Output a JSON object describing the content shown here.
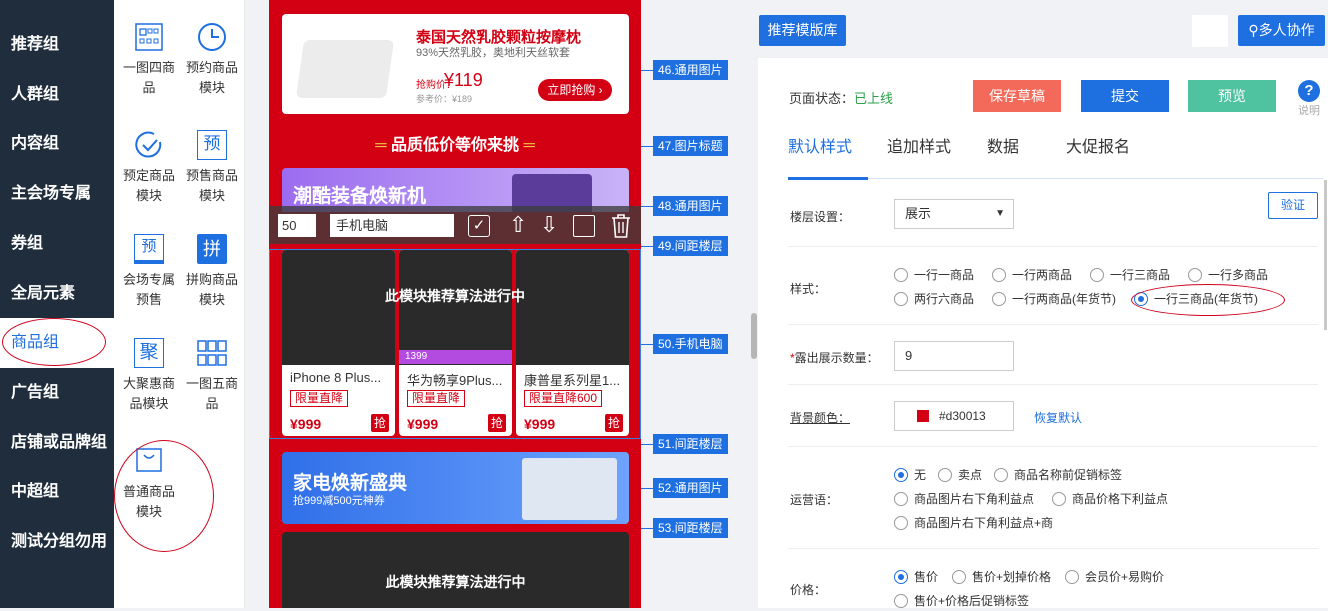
{
  "left_nav": {
    "groups": [
      {
        "label": "推荐组"
      },
      {
        "label": "人群组"
      },
      {
        "label": "内容组"
      },
      {
        "label": "主会场专属"
      },
      {
        "label": "券组"
      },
      {
        "label": "全局元素"
      },
      {
        "label": "商品组",
        "active": true
      },
      {
        "label": "广告组"
      },
      {
        "label": "店铺或品牌组"
      },
      {
        "label": "中超组"
      },
      {
        "label": "测试分组勿用"
      }
    ]
  },
  "modules": [
    {
      "label": "一图四商品",
      "icon": "grid-four-icon"
    },
    {
      "label": "预约商品模块",
      "icon": "clock-icon"
    },
    {
      "label": "预定商品模块",
      "icon": "check-circle-icon"
    },
    {
      "label": "预售商品模块",
      "icon": "yu-icon",
      "glyph": "预"
    },
    {
      "label": "会场专属预售",
      "icon": "yu-tag-icon",
      "glyph": "预"
    },
    {
      "label": "拼购商品模块",
      "icon": "pin-icon",
      "glyph": "拼"
    },
    {
      "label": "大聚惠商品模块",
      "icon": "ju-icon",
      "glyph": "聚"
    },
    {
      "label": "一图五商品",
      "icon": "grid-five-icon"
    },
    {
      "label": "普通商品模块",
      "icon": "bag-icon"
    }
  ],
  "canvas": {
    "top_banner": {
      "title": "泰国天然乳胶颗粒按摩枕",
      "subtitle": "93%天然乳胶，奥地利天丝软套",
      "price_label": "抢购价：",
      "price": "¥119",
      "ref_price": "参考价：¥189",
      "cta": "立即抢购 ›"
    },
    "title_bar": "品质低价等你来挑",
    "banner2": "潮酷装备焕新机",
    "toolbar": {
      "number": "50",
      "category": "手机电脑"
    },
    "overlay_text": "此模块推荐算法进行中",
    "products": [
      {
        "name": "iPhone 8 Plus...",
        "badge": "限量直降",
        "price": "¥999"
      },
      {
        "name": "华为畅享9Plus...",
        "badge": "限量直降",
        "price": "¥999"
      },
      {
        "name": "康普星系列星1...",
        "badge": "限量直降600",
        "price": "¥999"
      }
    ],
    "product_mid_tag": "1399",
    "qiang": "抢",
    "banner3": {
      "title": "家电焕新盛典",
      "sub": "抢999减500元神券"
    },
    "overlay_text_2": "此模块推荐算法进行中",
    "tags": [
      {
        "label": "46.通用图片"
      },
      {
        "label": "47.图片标题"
      },
      {
        "label": "48.通用图片"
      },
      {
        "label": "49.间距楼层"
      },
      {
        "label": "50.手机电脑"
      },
      {
        "label": "51.间距楼层"
      },
      {
        "label": "52.通用图片"
      },
      {
        "label": "53.间距楼层"
      }
    ]
  },
  "header": {
    "template_lib": "推荐模版库",
    "collab": "多人协作"
  },
  "right": {
    "status_label": "页面状态：",
    "status_value": "已上线",
    "save_draft": "保存草稿",
    "submit": "提交",
    "preview": "预览",
    "help": "说明",
    "tabs": [
      "默认样式",
      "追加样式",
      "数据",
      "大促报名"
    ],
    "floor_label": "楼层设置：",
    "floor_value": "展示",
    "verify": "验证",
    "style_label": "样式：",
    "style_options": [
      "一行一商品",
      "一行两商品",
      "一行三商品",
      "一行多商品",
      "两行六商品",
      "一行两商品(年货节)",
      "一行三商品(年货节)"
    ],
    "count_label": "露出展示数量：",
    "count_required": "*",
    "count_value": "9",
    "bg_label": "背景颜色：",
    "bg_value": "#d30013",
    "bg_reset": "恢复默认",
    "ops_label": "运营语：",
    "ops_options": [
      "无",
      "卖点",
      "商品名称前促销标签",
      "商品图片右下角利益点",
      "商品价格下利益点",
      "商品图片右下角利益点+商"
    ],
    "price_label": "价格：",
    "price_options": [
      "售价",
      "售价+划掉价格",
      "会员价+易购价",
      "售价+价格后促销标签"
    ]
  },
  "colors": {
    "brand": "#1e6fe0",
    "nav": "#1f2d3d",
    "red": "#d30013",
    "save": "#f36a5a",
    "preview": "#4fc39f",
    "online": "#2aa04a"
  }
}
